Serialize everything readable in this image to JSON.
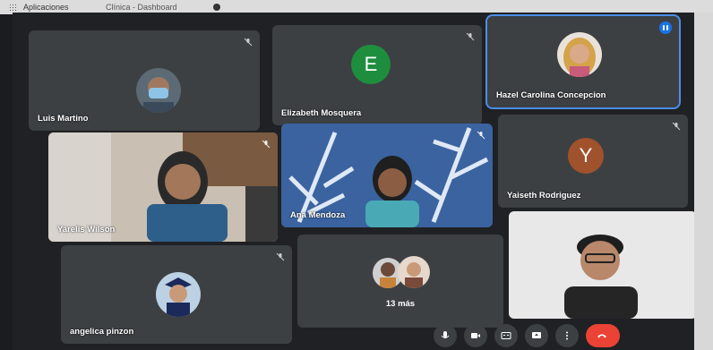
{
  "browser": {
    "bookmark_apps": "Aplicaciones",
    "bookmark_2": "Clínica - Dashboard"
  },
  "participants": [
    {
      "name": "Luis Martino",
      "muted": true
    },
    {
      "name": "Elizabeth Mosquera",
      "initial": "E",
      "avatar_color": "#1e8e3e",
      "muted": true
    },
    {
      "name": "Hazel Carolina Concepcion",
      "speaking": true
    },
    {
      "name": "Yarelis Wilson",
      "muted": true
    },
    {
      "name": "Ana Mendoza",
      "muted": true
    },
    {
      "name": "Yaiseth Rodriguez",
      "initial": "Y",
      "avatar_color": "#a0522d",
      "muted": true
    },
    {
      "name": "angelica pinzon",
      "muted": true
    },
    {
      "name": ""
    }
  ],
  "more_tile": {
    "label": "13 más"
  },
  "controls": {
    "mic": "mic-icon",
    "camera": "camera-icon",
    "captions": "captions-icon",
    "present": "present-icon",
    "more": "more-options-icon",
    "end_call": "end-call-icon",
    "end_color": "#ea4335"
  },
  "accent_color": "#4a8fe7"
}
